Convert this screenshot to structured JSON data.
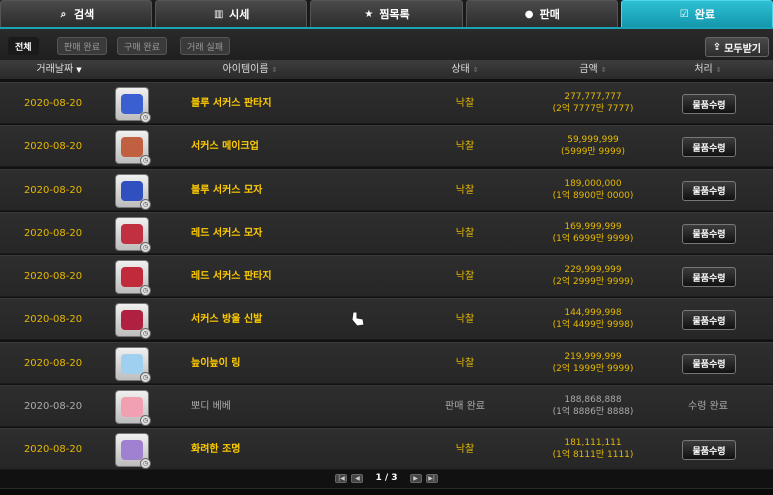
{
  "tabs": [
    {
      "label": "검색",
      "icon": "search-icon",
      "glyph": "⌕"
    },
    {
      "label": "시세",
      "icon": "bar-chart-icon",
      "glyph": "▥"
    },
    {
      "label": "찜목록",
      "icon": "star-icon",
      "glyph": "★"
    },
    {
      "label": "판매",
      "icon": "coin-icon",
      "glyph": "●"
    },
    {
      "label": "완료",
      "icon": "check-box-icon",
      "glyph": "☑"
    }
  ],
  "filters": {
    "all": "전체",
    "sale_done": "판매 완료",
    "buy_done": "구매 완료",
    "trade_failed": "거래 실패",
    "receive_all": "모두받기",
    "receive_icon": "upload-icon"
  },
  "columns": {
    "date": "거래날짜",
    "item": "아이템이름",
    "status": "상태",
    "amount": "금액",
    "action": "처리"
  },
  "rows": [
    {
      "date": "2020-08-20",
      "name": "블루 서커스 판타지",
      "status": "낙찰",
      "amount": "277,777,777",
      "amount_kr": "(2억 7777만 7777)",
      "action": "물품수령",
      "icon": "blue-circus-outfit-icon",
      "color": "#3a5fd0"
    },
    {
      "date": "2020-08-20",
      "name": "서커스 메이크업",
      "status": "낙찰",
      "amount": "59,999,999",
      "amount_kr": "(5999만 9999)",
      "action": "물품수령",
      "icon": "makeup-scroll-icon",
      "color": "#c06040"
    },
    {
      "date": "2020-08-20",
      "name": "블루 서커스 모자",
      "status": "낙찰",
      "amount": "189,000,000",
      "amount_kr": "(1억 8900만 0000)",
      "action": "물품수령",
      "icon": "blue-circus-hat-icon",
      "color": "#3050c0"
    },
    {
      "date": "2020-08-20",
      "name": "레드 서커스 모자",
      "status": "낙찰",
      "amount": "169,999,999",
      "amount_kr": "(1억 6999만 9999)",
      "action": "물품수령",
      "icon": "red-circus-hat-icon",
      "color": "#c03040"
    },
    {
      "date": "2020-08-20",
      "name": "레드 서커스 판타지",
      "status": "낙찰",
      "amount": "229,999,999",
      "amount_kr": "(2억 2999만 9999)",
      "action": "물품수령",
      "icon": "red-circus-outfit-icon",
      "color": "#c02a3a"
    },
    {
      "date": "2020-08-20",
      "name": "서커스 방울 신발",
      "status": "낙찰",
      "amount": "144,999,998",
      "amount_kr": "(1억 4499만 9998)",
      "action": "물품수령",
      "icon": "circus-shoes-icon",
      "color": "#b02040"
    },
    {
      "date": "2020-08-20",
      "name": "늪이늪이 링",
      "status": "낙찰",
      "amount": "219,999,999",
      "amount_kr": "(2억 1999만 9999)",
      "action": "물품수령",
      "icon": "ring-effect-icon",
      "color": "#9fd0f0"
    },
    {
      "date": "2020-08-20",
      "name": "뽀디 베베",
      "status": "판매 완료",
      "amount": "188,868,888",
      "amount_kr": "(1억 8886만 8888)",
      "action": "수령 완료",
      "icon": "pet-doll-icon",
      "color": "#f0a0b0",
      "done": true
    },
    {
      "date": "2020-08-20",
      "name": "화려한 조명",
      "status": "낙찰",
      "amount": "181,111,111",
      "amount_kr": "(1억 8111만 1111)",
      "action": "물품수령",
      "icon": "spotlight-effect-icon",
      "color": "#a080d0"
    }
  ],
  "pager": {
    "text": "1 / 3"
  }
}
